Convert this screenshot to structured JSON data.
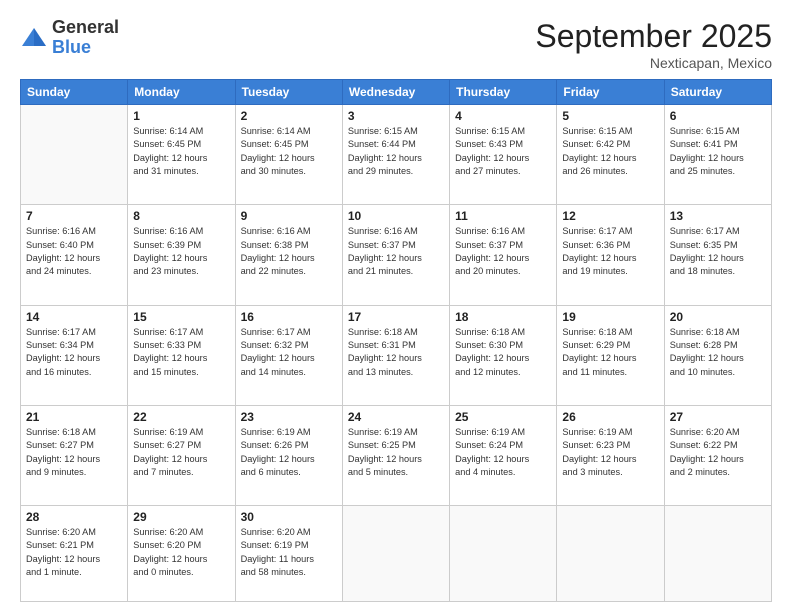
{
  "logo": {
    "general": "General",
    "blue": "Blue"
  },
  "header": {
    "month": "September 2025",
    "location": "Nexticapan, Mexico"
  },
  "days_of_week": [
    "Sunday",
    "Monday",
    "Tuesday",
    "Wednesday",
    "Thursday",
    "Friday",
    "Saturday"
  ],
  "weeks": [
    [
      {
        "day": "",
        "info": ""
      },
      {
        "day": "1",
        "info": "Sunrise: 6:14 AM\nSunset: 6:45 PM\nDaylight: 12 hours\nand 31 minutes."
      },
      {
        "day": "2",
        "info": "Sunrise: 6:14 AM\nSunset: 6:45 PM\nDaylight: 12 hours\nand 30 minutes."
      },
      {
        "day": "3",
        "info": "Sunrise: 6:15 AM\nSunset: 6:44 PM\nDaylight: 12 hours\nand 29 minutes."
      },
      {
        "day": "4",
        "info": "Sunrise: 6:15 AM\nSunset: 6:43 PM\nDaylight: 12 hours\nand 27 minutes."
      },
      {
        "day": "5",
        "info": "Sunrise: 6:15 AM\nSunset: 6:42 PM\nDaylight: 12 hours\nand 26 minutes."
      },
      {
        "day": "6",
        "info": "Sunrise: 6:15 AM\nSunset: 6:41 PM\nDaylight: 12 hours\nand 25 minutes."
      }
    ],
    [
      {
        "day": "7",
        "info": "Sunrise: 6:16 AM\nSunset: 6:40 PM\nDaylight: 12 hours\nand 24 minutes."
      },
      {
        "day": "8",
        "info": "Sunrise: 6:16 AM\nSunset: 6:39 PM\nDaylight: 12 hours\nand 23 minutes."
      },
      {
        "day": "9",
        "info": "Sunrise: 6:16 AM\nSunset: 6:38 PM\nDaylight: 12 hours\nand 22 minutes."
      },
      {
        "day": "10",
        "info": "Sunrise: 6:16 AM\nSunset: 6:37 PM\nDaylight: 12 hours\nand 21 minutes."
      },
      {
        "day": "11",
        "info": "Sunrise: 6:16 AM\nSunset: 6:37 PM\nDaylight: 12 hours\nand 20 minutes."
      },
      {
        "day": "12",
        "info": "Sunrise: 6:17 AM\nSunset: 6:36 PM\nDaylight: 12 hours\nand 19 minutes."
      },
      {
        "day": "13",
        "info": "Sunrise: 6:17 AM\nSunset: 6:35 PM\nDaylight: 12 hours\nand 18 minutes."
      }
    ],
    [
      {
        "day": "14",
        "info": "Sunrise: 6:17 AM\nSunset: 6:34 PM\nDaylight: 12 hours\nand 16 minutes."
      },
      {
        "day": "15",
        "info": "Sunrise: 6:17 AM\nSunset: 6:33 PM\nDaylight: 12 hours\nand 15 minutes."
      },
      {
        "day": "16",
        "info": "Sunrise: 6:17 AM\nSunset: 6:32 PM\nDaylight: 12 hours\nand 14 minutes."
      },
      {
        "day": "17",
        "info": "Sunrise: 6:18 AM\nSunset: 6:31 PM\nDaylight: 12 hours\nand 13 minutes."
      },
      {
        "day": "18",
        "info": "Sunrise: 6:18 AM\nSunset: 6:30 PM\nDaylight: 12 hours\nand 12 minutes."
      },
      {
        "day": "19",
        "info": "Sunrise: 6:18 AM\nSunset: 6:29 PM\nDaylight: 12 hours\nand 11 minutes."
      },
      {
        "day": "20",
        "info": "Sunrise: 6:18 AM\nSunset: 6:28 PM\nDaylight: 12 hours\nand 10 minutes."
      }
    ],
    [
      {
        "day": "21",
        "info": "Sunrise: 6:18 AM\nSunset: 6:27 PM\nDaylight: 12 hours\nand 9 minutes."
      },
      {
        "day": "22",
        "info": "Sunrise: 6:19 AM\nSunset: 6:27 PM\nDaylight: 12 hours\nand 7 minutes."
      },
      {
        "day": "23",
        "info": "Sunrise: 6:19 AM\nSunset: 6:26 PM\nDaylight: 12 hours\nand 6 minutes."
      },
      {
        "day": "24",
        "info": "Sunrise: 6:19 AM\nSunset: 6:25 PM\nDaylight: 12 hours\nand 5 minutes."
      },
      {
        "day": "25",
        "info": "Sunrise: 6:19 AM\nSunset: 6:24 PM\nDaylight: 12 hours\nand 4 minutes."
      },
      {
        "day": "26",
        "info": "Sunrise: 6:19 AM\nSunset: 6:23 PM\nDaylight: 12 hours\nand 3 minutes."
      },
      {
        "day": "27",
        "info": "Sunrise: 6:20 AM\nSunset: 6:22 PM\nDaylight: 12 hours\nand 2 minutes."
      }
    ],
    [
      {
        "day": "28",
        "info": "Sunrise: 6:20 AM\nSunset: 6:21 PM\nDaylight: 12 hours\nand 1 minute."
      },
      {
        "day": "29",
        "info": "Sunrise: 6:20 AM\nSunset: 6:20 PM\nDaylight: 12 hours\nand 0 minutes."
      },
      {
        "day": "30",
        "info": "Sunrise: 6:20 AM\nSunset: 6:19 PM\nDaylight: 11 hours\nand 58 minutes."
      },
      {
        "day": "",
        "info": ""
      },
      {
        "day": "",
        "info": ""
      },
      {
        "day": "",
        "info": ""
      },
      {
        "day": "",
        "info": ""
      }
    ]
  ]
}
